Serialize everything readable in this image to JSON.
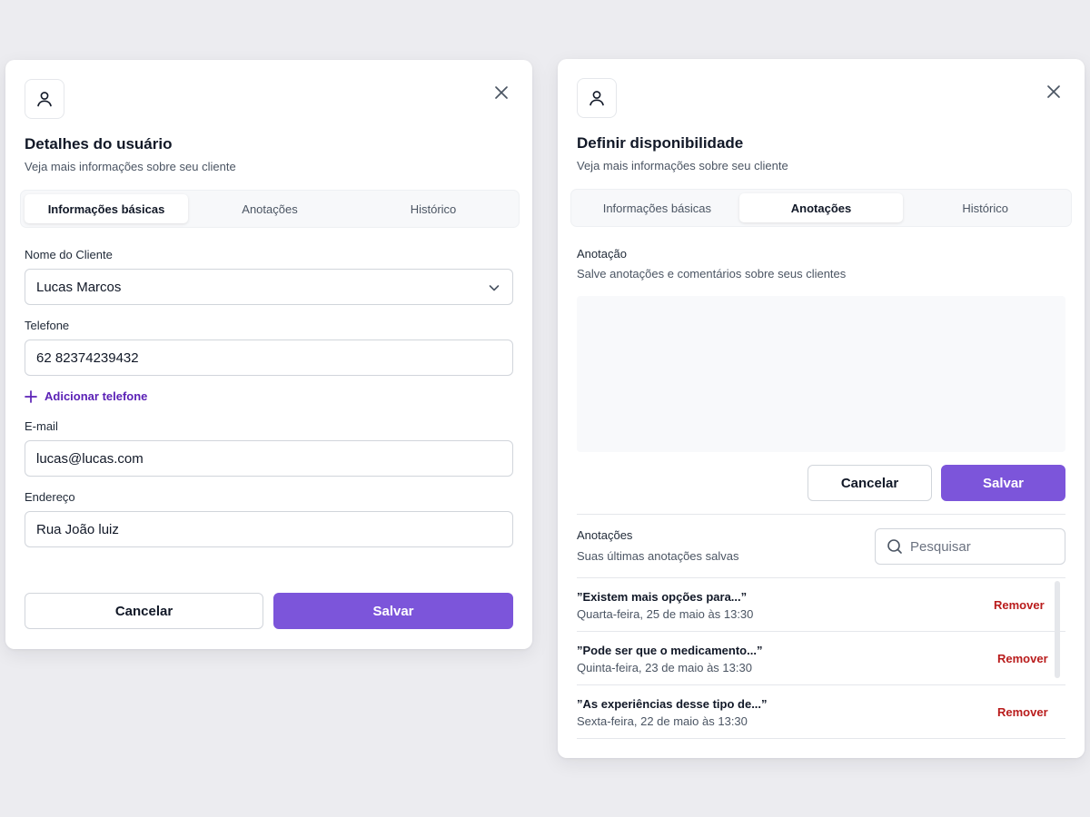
{
  "colors": {
    "background": "#ECECF0",
    "accent": "#7C55DA",
    "link": "#5B21B6",
    "danger": "#B91C1C"
  },
  "user_details_modal": {
    "icon": "user-icon",
    "close_icon": "close-icon",
    "title": "Detalhes do usuário",
    "subtitle": "Veja mais informações sobre seu cliente",
    "tabs": [
      {
        "label": "Informações básicas",
        "active": true
      },
      {
        "label": "Anotações",
        "active": false
      },
      {
        "label": "Histórico",
        "active": false
      }
    ],
    "client_name": {
      "label": "Nome do Cliente",
      "value": "Lucas Marcos",
      "icon": "chevron-down-icon"
    },
    "phone": {
      "label": "Telefone",
      "value": "62 82374239432"
    },
    "add_phone": {
      "label": "Adicionar telefone",
      "icon": "plus-icon"
    },
    "email": {
      "label": "E-mail",
      "value": "lucas@lucas.com"
    },
    "address": {
      "label": "Endereço",
      "value": "Rua João luiz"
    },
    "cancel_label": "Cancelar",
    "save_label": "Salvar"
  },
  "availability_modal": {
    "icon": "user-icon",
    "close_icon": "close-icon",
    "title": "Definir disponibilidade",
    "subtitle": "Veja mais informações sobre seu cliente",
    "tabs": [
      {
        "label": "Informações básicas",
        "active": false
      },
      {
        "label": "Anotações",
        "active": true
      },
      {
        "label": "Histórico",
        "active": false
      }
    ],
    "note_section": {
      "label": "Anotação",
      "description": "Salve anotações e comentários sobre seus clientes",
      "note_value": ""
    },
    "cancel_label": "Cancelar",
    "save_label": "Salvar",
    "notes_list": {
      "title": "Anotações",
      "subtitle": "Suas últimas anotações salvas",
      "search_placeholder": "Pesquisar",
      "search_icon": "search-icon",
      "items": [
        {
          "title": "”Existem mais opções para...”",
          "date": "Quarta-feira, 25 de maio às 13:30",
          "action": "Remover"
        },
        {
          "title": "”Pode ser que o medicamento...”",
          "date": "Quinta-feira, 23 de maio às 13:30",
          "action": "Remover"
        },
        {
          "title": "”As experiências desse tipo de...”",
          "date": "Sexta-feira, 22 de maio às 13:30",
          "action": "Remover"
        }
      ]
    }
  }
}
